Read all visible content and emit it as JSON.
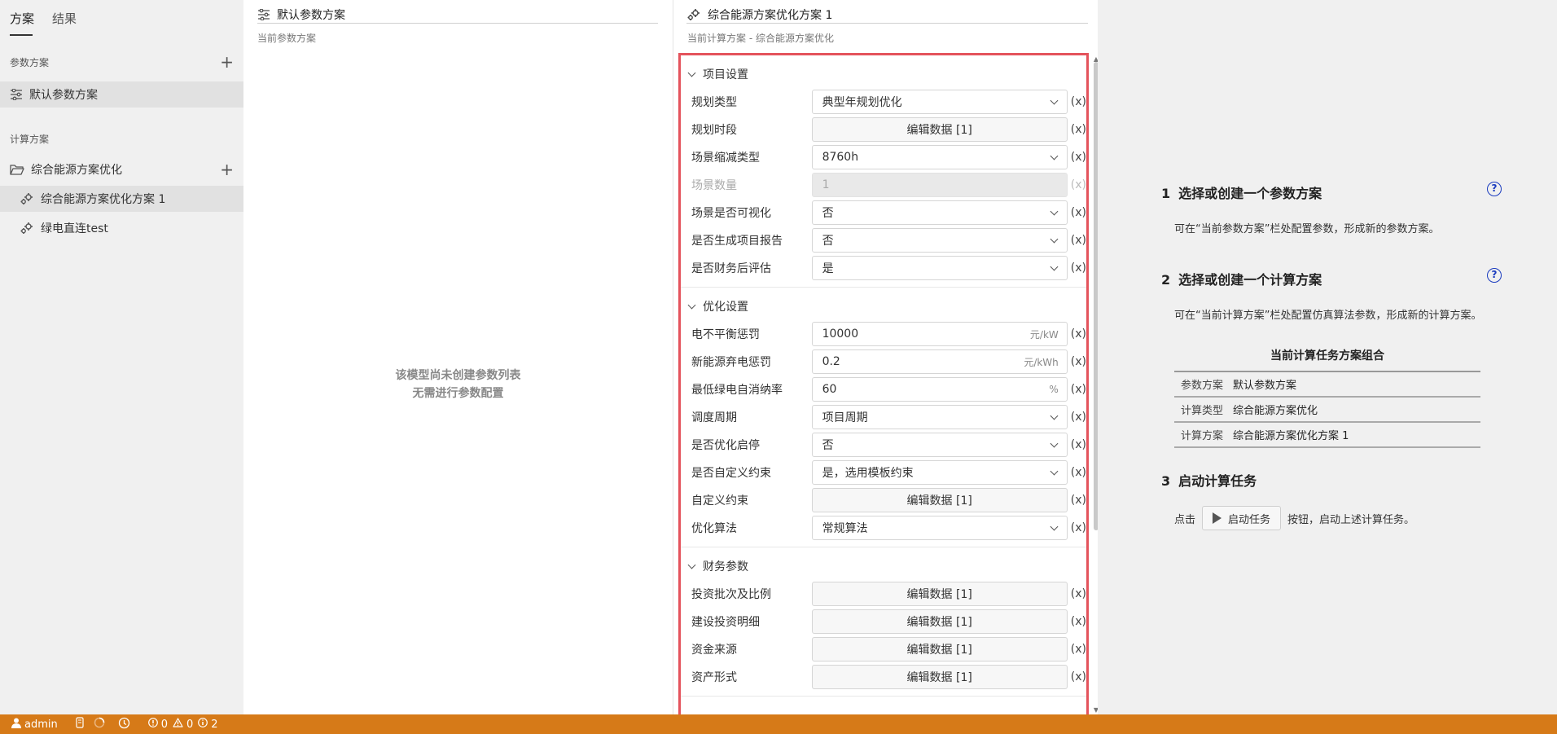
{
  "sidebar": {
    "tabs": [
      "方案",
      "结果"
    ],
    "param_section": "参数方案",
    "param_items": [
      "默认参数方案"
    ],
    "calc_section": "计算方案",
    "calc_folder": "综合能源方案优化",
    "calc_items": [
      "综合能源方案优化方案 1",
      "绿电直连test"
    ]
  },
  "param_panel": {
    "title": "默认参数方案",
    "subtitle": "当前参数方案",
    "empty_line1": "该模型尚未创建参数列表",
    "empty_line2": "无需进行参数配置"
  },
  "scheme_panel": {
    "title": "综合能源方案优化方案 1",
    "subtitle": "当前计算方案 - 综合能源方案优化",
    "x_label": "(x)",
    "groups": [
      {
        "title": "项目设置",
        "rows": [
          {
            "label": "规划类型",
            "kind": "select",
            "value": "典型年规划优化"
          },
          {
            "label": "规划时段",
            "kind": "button",
            "value": "编辑数据 [1]"
          },
          {
            "label": "场景缩减类型",
            "kind": "select",
            "value": "8760h"
          },
          {
            "label": "场景数量",
            "kind": "disabled",
            "value": "1"
          },
          {
            "label": "场景是否可视化",
            "kind": "select",
            "value": "否"
          },
          {
            "label": "是否生成项目报告",
            "kind": "select",
            "value": "否"
          },
          {
            "label": "是否财务后评估",
            "kind": "select",
            "value": "是"
          }
        ]
      },
      {
        "title": "优化设置",
        "rows": [
          {
            "label": "电不平衡惩罚",
            "kind": "input",
            "value": "10000",
            "unit": "元/kW"
          },
          {
            "label": "新能源弃电惩罚",
            "kind": "input",
            "value": "0.2",
            "unit": "元/kWh"
          },
          {
            "label": "最低绿电自消纳率",
            "kind": "input",
            "value": "60",
            "unit": "%"
          },
          {
            "label": "调度周期",
            "kind": "select",
            "value": "项目周期"
          },
          {
            "label": "是否优化启停",
            "kind": "select",
            "value": "否"
          },
          {
            "label": "是否自定义约束",
            "kind": "select",
            "value": "是，选用模板约束"
          },
          {
            "label": "自定义约束",
            "kind": "button",
            "value": "编辑数据 [1]"
          },
          {
            "label": "优化算法",
            "kind": "select",
            "value": "常规算法"
          }
        ]
      },
      {
        "title": "财务参数",
        "rows": [
          {
            "label": "投资批次及比例",
            "kind": "button",
            "value": "编辑数据 [1]"
          },
          {
            "label": "建设投资明细",
            "kind": "button",
            "value": "编辑数据 [1]"
          },
          {
            "label": "资金来源",
            "kind": "button",
            "value": "编辑数据 [1]"
          },
          {
            "label": "资产形式",
            "kind": "button",
            "value": "编辑数据 [1]"
          }
        ]
      }
    ]
  },
  "guide": {
    "step1_num": "1",
    "step1_title": "选择或创建一个参数方案",
    "step1_desc": "可在“当前参数方案”栏处配置参数，形成新的参数方案。",
    "step2_num": "2",
    "step2_title": "选择或创建一个计算方案",
    "step2_desc": "可在“当前计算方案”栏处配置仿真算法参数，形成新的计算方案。",
    "help_glyph": "?",
    "table_title": "当前计算任务方案组合",
    "table_rows": [
      {
        "k": "参数方案",
        "v": "默认参数方案"
      },
      {
        "k": "计算类型",
        "v": "综合能源方案优化"
      },
      {
        "k": "计算方案",
        "v": "综合能源方案优化方案 1"
      }
    ],
    "step3_num": "3",
    "step3_title": "启动计算任务",
    "start_prefix": "点击",
    "start_button": "启动任务",
    "start_suffix": "按钮，启动上述计算任务。"
  },
  "status_bar": {
    "user": "admin",
    "errors": "0",
    "warnings": "0",
    "infos": "2"
  }
}
